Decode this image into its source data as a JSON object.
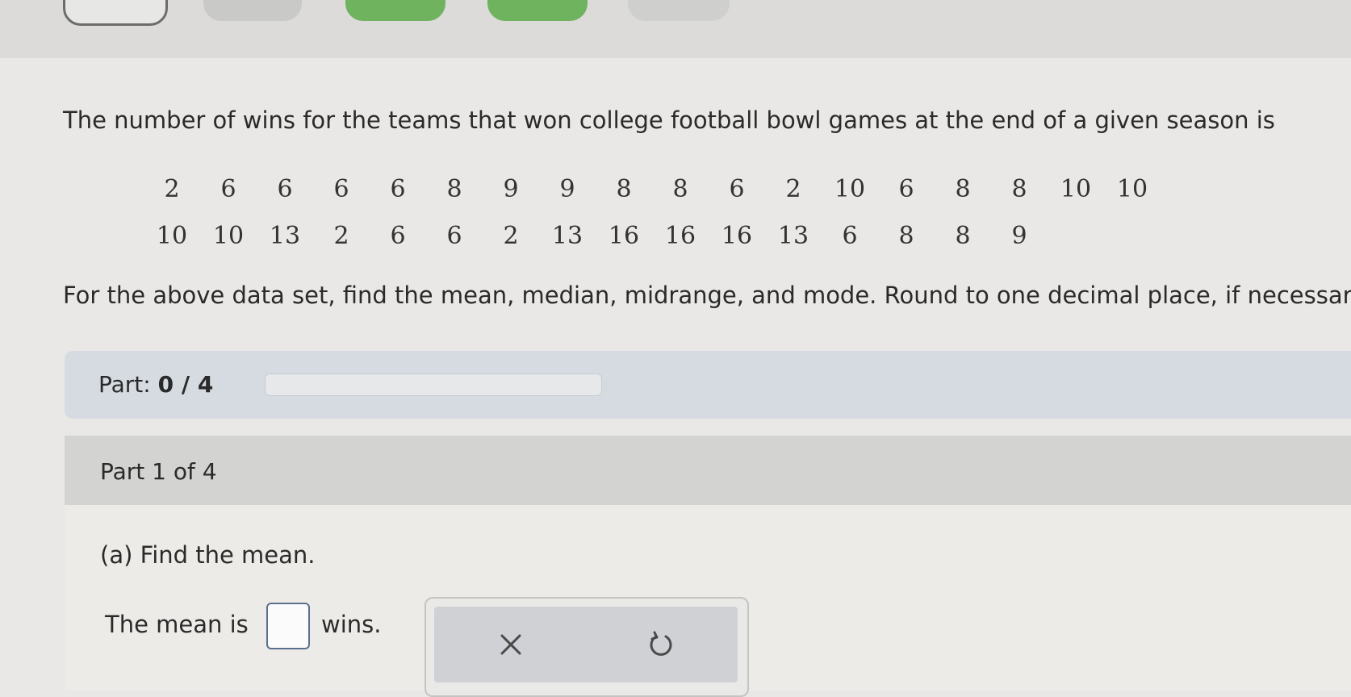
{
  "problem": {
    "intro": "The number of wins for the teams that won college football bowl games at the end of a given season is",
    "data_rows": [
      [
        "2",
        "6",
        "6",
        "6",
        "6",
        "8",
        "9",
        "9",
        "8",
        "8",
        "6",
        "2",
        "10",
        "6",
        "8",
        "8",
        "10",
        "10"
      ],
      [
        "10",
        "10",
        "13",
        "2",
        "6",
        "6",
        "2",
        "13",
        "16",
        "16",
        "16",
        "13",
        "6",
        "8",
        "8",
        "9"
      ]
    ],
    "instructions": "For the above data set, find the mean, median, midrange, and mode. Round to one decimal place, if necessar"
  },
  "progress": {
    "label_prefix": "Part: ",
    "value": "0 / 4",
    "fraction": 0
  },
  "part": {
    "title": "Part 1 of 4",
    "question": "(a) Find the mean.",
    "answer_prefix": "The mean is",
    "answer_value": "",
    "answer_suffix": "wins."
  },
  "tools": {
    "clear_icon": "x-icon",
    "undo_icon": "undo-icon"
  },
  "colors": {
    "accent_green": "#6fb35e",
    "input_border": "#5b6f8e"
  }
}
